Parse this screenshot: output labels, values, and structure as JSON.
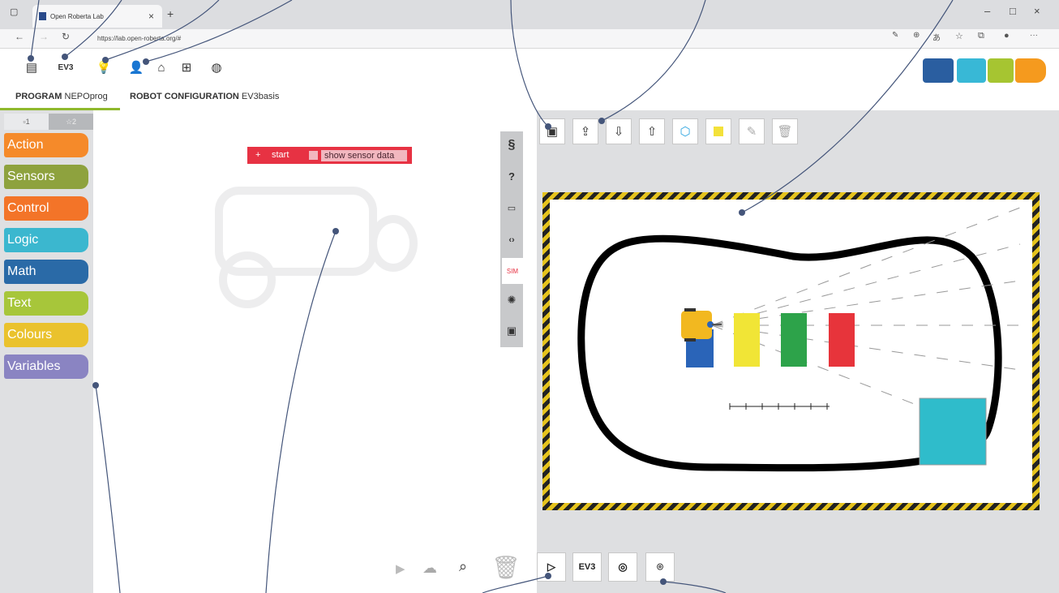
{
  "browser": {
    "tab_title": "Open Roberta Lab",
    "tab_close": "×",
    "new_tab": "+",
    "url": "https://lab.open-roberta.org/#",
    "win_min": "–",
    "win_max": "□",
    "win_close": "×"
  },
  "header": {
    "robot_label": "EV3",
    "program_tab_bold": "PROGRAM",
    "program_tab_name": "NEPOprog",
    "config_tab_bold": "ROBOT CONFIGURATION",
    "config_tab_name": "EV3basis",
    "logo_colors": [
      "#2a5ea0",
      "#38b8d6",
      "#a6c531",
      "#f59a1e"
    ]
  },
  "palette": {
    "tabs": [
      "▫1",
      "☆2"
    ],
    "categories": [
      {
        "label": "Action",
        "color": "#f58a2a"
      },
      {
        "label": "Sensors",
        "color": "#8ea23e"
      },
      {
        "label": "Control",
        "color": "#f37428"
      },
      {
        "label": "Logic",
        "color": "#3bb7cf"
      },
      {
        "label": "Math",
        "color": "#2a6aa7"
      },
      {
        "label": "Text",
        "color": "#a7c63a"
      },
      {
        "label": "Colours",
        "color": "#eac22d"
      },
      {
        "label": "Variables",
        "color": "#8a84c2"
      }
    ]
  },
  "program": {
    "start_label": "start",
    "sensor_label": "show sensor data"
  },
  "side_tools": [
    "§",
    "?",
    "▭",
    "‹›",
    "SIM",
    "✺",
    "▣"
  ],
  "sim": {
    "bottom_robot_label": "EV3",
    "block_colors": [
      "#2a64b8",
      "#f1e536",
      "#2da34a",
      "#e7343b"
    ],
    "robot_color": "#f2b820",
    "target_color": "#2fbccb"
  }
}
